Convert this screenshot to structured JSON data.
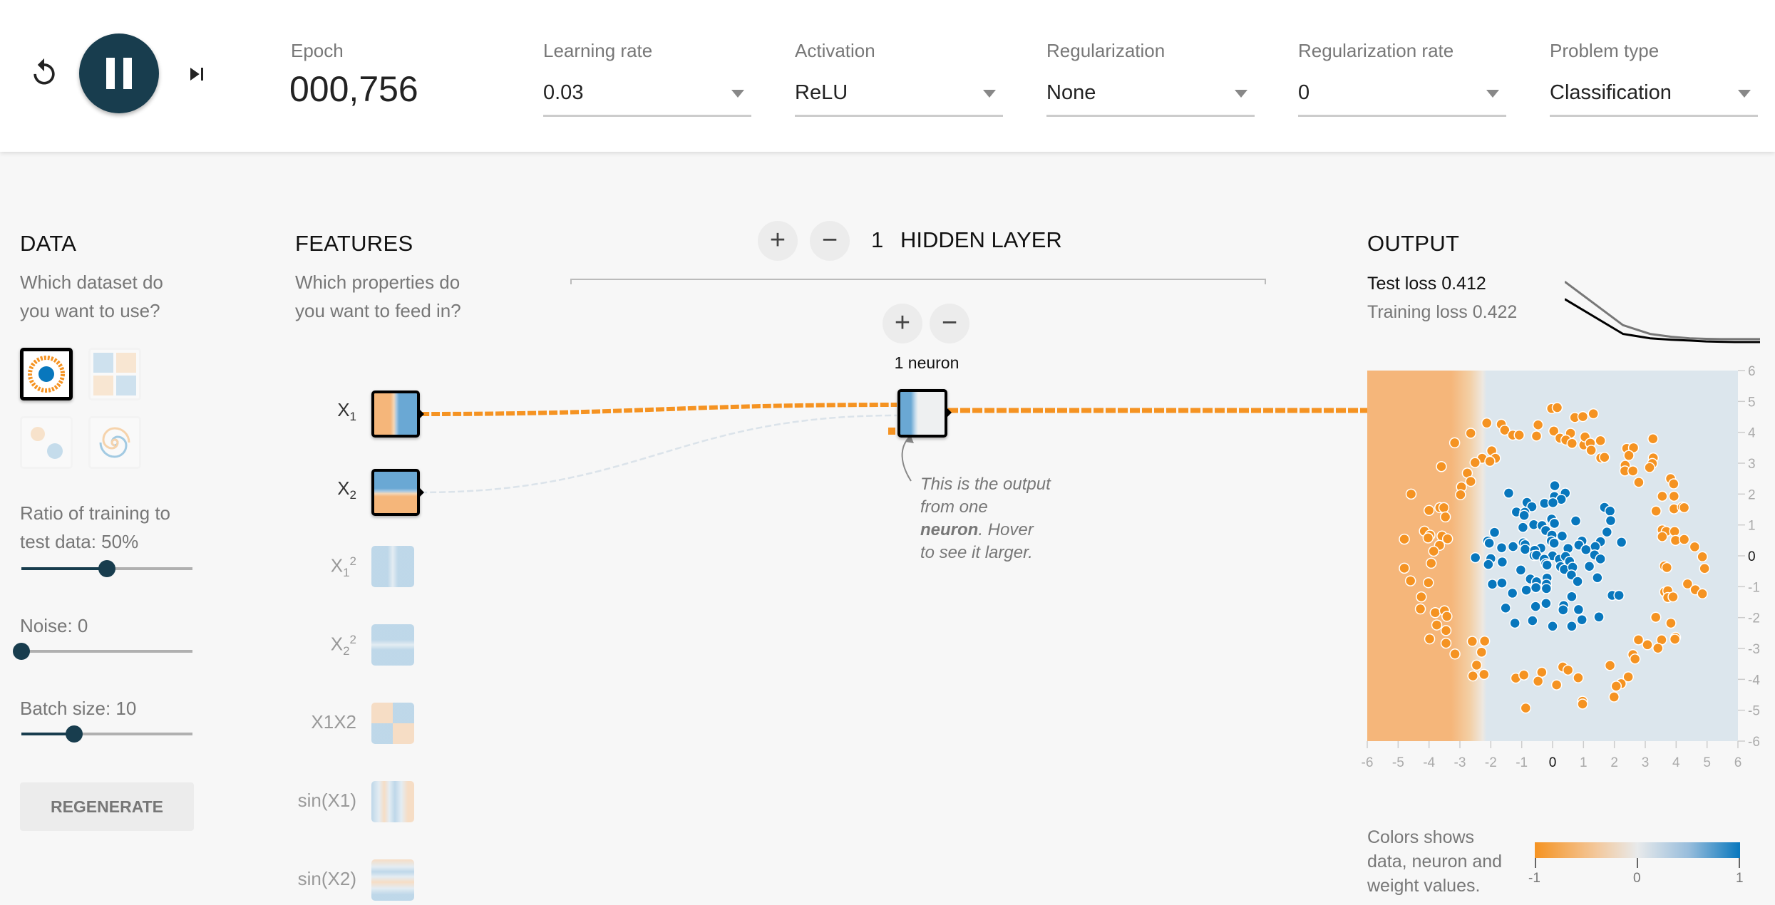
{
  "topbar": {
    "reset_icon": "reset-icon",
    "play_state": "pause",
    "step_icon": "step-forward-icon",
    "epoch_label": "Epoch",
    "epoch_value": "000,756",
    "controls": [
      {
        "label": "Learning rate",
        "value": "0.03"
      },
      {
        "label": "Activation",
        "value": "ReLU"
      },
      {
        "label": "Regularization",
        "value": "None"
      },
      {
        "label": "Regularization rate",
        "value": "0"
      },
      {
        "label": "Problem type",
        "value": "Classification"
      }
    ]
  },
  "data": {
    "title": "DATA",
    "subtitle_line1": "Which dataset do",
    "subtitle_line2": "you want to use?",
    "datasets": [
      {
        "name": "circle",
        "selected": true
      },
      {
        "name": "xor",
        "selected": false
      },
      {
        "name": "gaussian",
        "selected": false
      },
      {
        "name": "spiral",
        "selected": false
      }
    ],
    "ratio_label_line1": "Ratio of training to",
    "ratio_label_line2": "test data:  50%",
    "ratio_value": 50,
    "noise_label": "Noise:  0",
    "noise_value": 0,
    "batch_label": "Batch size:  10",
    "batch_value": 10,
    "regenerate_label": "REGENERATE"
  },
  "features": {
    "title": "FEATURES",
    "subtitle_line1": "Which properties do",
    "subtitle_line2": "you want to feed in?",
    "items": [
      {
        "label": "X",
        "sub": "1",
        "sup": "",
        "active": true
      },
      {
        "label": "X",
        "sub": "2",
        "sup": "",
        "active": true
      },
      {
        "label": "X",
        "sub": "1",
        "sup": "2",
        "active": false
      },
      {
        "label": "X",
        "sub": "2",
        "sup": "2",
        "active": false
      },
      {
        "label": "X1X2",
        "sub": "",
        "sup": "",
        "active": false
      },
      {
        "label": "sin(X1)",
        "sub": "",
        "sup": "",
        "active": false
      },
      {
        "label": "sin(X2)",
        "sub": "",
        "sup": "",
        "active": false
      }
    ]
  },
  "network": {
    "layer_count": "1",
    "layer_label": "HIDDEN LAYER",
    "add_layer": "+",
    "remove_layer": "−",
    "add_neuron": "+",
    "remove_neuron": "−",
    "neuron_count_label": "1 neuron",
    "note_line1": "This is the output",
    "note_line2": "from one",
    "note_bold": "neuron",
    "note_line3_rest": ". Hover",
    "note_line4": "to see it larger."
  },
  "output": {
    "title": "OUTPUT",
    "test_loss_label": "Test loss",
    "test_loss_value": "0.412",
    "training_loss_label": "Training loss",
    "training_loss_value": "0.422",
    "legend_text_line1": "Colors shows",
    "legend_text_line2": "data, neuron and",
    "legend_text_line3": "weight values.",
    "legend_ticks": [
      "-1",
      "0",
      "1"
    ]
  },
  "colors": {
    "orange": "#f59322",
    "blue": "#0877bd",
    "dark": "#183d4e",
    "bg_orange": "#f5b67a",
    "bg_blue": "#dce6ed"
  },
  "chart_data": {
    "type": "scatter",
    "title": "OUTPUT",
    "xlim": [
      -6,
      6
    ],
    "ylim": [
      -6,
      6
    ],
    "x_ticks": [
      "-6",
      "-5",
      "-4",
      "-3",
      "-2",
      "-1",
      "0",
      "1",
      "2",
      "3",
      "4",
      "5",
      "6"
    ],
    "y_ticks": [
      "6",
      "5",
      "4",
      "3",
      "2",
      "1",
      "0",
      "-1",
      "-2",
      "-3",
      "-4",
      "-5",
      "-6"
    ],
    "decision_boundary_x": -2.2,
    "series": [
      {
        "name": "orange (-1)",
        "color": "#f59322",
        "points": [
          [
            -0.03,
            4.77
          ],
          [
            0.15,
            4.8
          ],
          [
            0.72,
            4.48
          ],
          [
            0.98,
            4.51
          ],
          [
            1.32,
            4.6
          ],
          [
            -2.13,
            4.3
          ],
          [
            -1.66,
            4.26
          ],
          [
            -1.55,
            4.07
          ],
          [
            -0.47,
            4.24
          ],
          [
            0.04,
            4.04
          ],
          [
            -2.65,
            3.97
          ],
          [
            -1.29,
            3.91
          ],
          [
            -1.08,
            3.91
          ],
          [
            -0.52,
            3.88
          ],
          [
            0.58,
            3.97
          ],
          [
            -3.17,
            3.66
          ],
          [
            0.24,
            3.81
          ],
          [
            0.43,
            3.75
          ],
          [
            0.63,
            3.64
          ],
          [
            1.01,
            3.59
          ],
          [
            1.05,
            3.85
          ],
          [
            1.22,
            3.65
          ],
          [
            1.25,
            3.42
          ],
          [
            1.55,
            3.73
          ],
          [
            -1.97,
            3.4
          ],
          [
            -2.28,
            3.16
          ],
          [
            -1.85,
            3.16
          ],
          [
            -2.03,
            3.06
          ],
          [
            -2.51,
            3.02
          ],
          [
            -3.6,
            2.89
          ],
          [
            1.56,
            3.17
          ],
          [
            1.68,
            3.19
          ],
          [
            2.4,
            3.48
          ],
          [
            2.62,
            3.5
          ],
          [
            2.47,
            3.25
          ],
          [
            3.25,
            3.79
          ],
          [
            3.26,
            3.17
          ],
          [
            3.23,
            2.99
          ],
          [
            3.14,
            2.86
          ],
          [
            2.35,
            2.93
          ],
          [
            2.34,
            2.75
          ],
          [
            2.6,
            2.75
          ],
          [
            2.79,
            2.38
          ],
          [
            3.82,
            2.5
          ],
          [
            3.92,
            2.33
          ],
          [
            -2.76,
            2.68
          ],
          [
            -2.65,
            2.41
          ],
          [
            -2.95,
            2.23
          ],
          [
            -2.98,
            1.98
          ],
          [
            -4.58,
            2.0
          ],
          [
            3.55,
            1.93
          ],
          [
            3.93,
            1.93
          ],
          [
            3.35,
            1.45
          ],
          [
            3.93,
            1.52
          ],
          [
            4.2,
            1.58
          ],
          [
            4.26,
            1.56
          ],
          [
            -4.0,
            1.47
          ],
          [
            -3.65,
            1.56
          ],
          [
            -3.52,
            1.56
          ],
          [
            -3.47,
            1.26
          ],
          [
            -4.15,
            0.8
          ],
          [
            -3.97,
            0.67
          ],
          [
            -4.03,
            0.58
          ],
          [
            -3.58,
            0.64
          ],
          [
            -3.4,
            0.55
          ],
          [
            -3.66,
            0.34
          ],
          [
            -3.85,
            0.15
          ],
          [
            -4.8,
            0.54
          ],
          [
            3.55,
            0.84
          ],
          [
            3.68,
            0.79
          ],
          [
            3.55,
            0.62
          ],
          [
            3.95,
            0.79
          ],
          [
            3.98,
            0.5
          ],
          [
            4.26,
            0.53
          ],
          [
            4.6,
            0.29
          ],
          [
            4.85,
            -0.03
          ],
          [
            4.92,
            -0.41
          ],
          [
            -3.93,
            -0.24
          ],
          [
            -4.8,
            -0.4
          ],
          [
            -4.6,
            -0.81
          ],
          [
            -4.02,
            -0.87
          ],
          [
            -4.25,
            -1.33
          ],
          [
            3.62,
            -0.33
          ],
          [
            3.7,
            -0.38
          ],
          [
            4.37,
            -0.91
          ],
          [
            4.62,
            -1.1
          ],
          [
            4.85,
            -1.23
          ],
          [
            3.63,
            -1.17
          ],
          [
            3.73,
            -1.13
          ],
          [
            3.73,
            -1.35
          ],
          [
            3.9,
            -1.33
          ],
          [
            -4.28,
            -1.72
          ],
          [
            -3.8,
            -1.84
          ],
          [
            -3.5,
            -1.78
          ],
          [
            -3.42,
            -1.96
          ],
          [
            -3.75,
            -2.24
          ],
          [
            -3.45,
            -2.42
          ],
          [
            -3.98,
            -2.69
          ],
          [
            -3.45,
            -2.83
          ],
          [
            3.34,
            -1.99
          ],
          [
            3.83,
            -2.18
          ],
          [
            2.78,
            -2.72
          ],
          [
            3.07,
            -2.88
          ],
          [
            3.53,
            -2.72
          ],
          [
            3.41,
            -2.99
          ],
          [
            3.98,
            -2.64
          ],
          [
            3.96,
            -2.7
          ],
          [
            -2.6,
            -2.77
          ],
          [
            -2.2,
            -2.76
          ],
          [
            -2.3,
            -3.12
          ],
          [
            -3.16,
            -3.18
          ],
          [
            -2.46,
            -3.54
          ],
          [
            -2.58,
            -3.89
          ],
          [
            -2.22,
            -3.84
          ],
          [
            2.6,
            -3.2
          ],
          [
            2.67,
            -3.34
          ],
          [
            1.86,
            -3.55
          ],
          [
            2.45,
            -3.92
          ],
          [
            2.22,
            -4.14
          ],
          [
            2.06,
            -4.22
          ],
          [
            1.99,
            -4.57
          ],
          [
            -1.19,
            -3.96
          ],
          [
            -0.93,
            -3.86
          ],
          [
            -0.35,
            -3.77
          ],
          [
            -0.47,
            -4.06
          ],
          [
            0.33,
            -3.6
          ],
          [
            0.5,
            -3.7
          ],
          [
            0.83,
            -3.95
          ],
          [
            0.13,
            -4.18
          ],
          [
            0.97,
            -4.71
          ],
          [
            0.97,
            -4.8
          ],
          [
            -0.87,
            -4.93
          ]
        ]
      },
      {
        "name": "blue (+1)",
        "color": "#0877bd",
        "points": [
          [
            0.07,
            2.27
          ],
          [
            0.41,
            2.03
          ],
          [
            -1.42,
            2.03
          ],
          [
            0.06,
            1.92
          ],
          [
            0.28,
            1.83
          ],
          [
            -0.83,
            1.73
          ],
          [
            -0.26,
            1.7
          ],
          [
            0.01,
            1.72
          ],
          [
            -0.67,
            1.59
          ],
          [
            -1.17,
            1.42
          ],
          [
            -0.9,
            1.41
          ],
          [
            -0.92,
            1.31
          ],
          [
            1.68,
            1.57
          ],
          [
            1.86,
            1.45
          ],
          [
            1.88,
            1.14
          ],
          [
            -0.03,
            1.19
          ],
          [
            0.06,
            1.05
          ],
          [
            -0.61,
            1.01
          ],
          [
            -0.34,
            0.98
          ],
          [
            0.75,
            1.13
          ],
          [
            -0.96,
            0.92
          ],
          [
            -0.22,
            0.82
          ],
          [
            -1.88,
            0.76
          ],
          [
            -0.02,
            0.67
          ],
          [
            0.31,
            0.64
          ],
          [
            1.76,
            0.77
          ],
          [
            -2.1,
            0.48
          ],
          [
            -2.05,
            0.41
          ],
          [
            0.95,
            0.48
          ],
          [
            1.55,
            0.46
          ],
          [
            2.23,
            0.44
          ],
          [
            -0.95,
            0.42
          ],
          [
            -0.89,
            0.36
          ],
          [
            -0.04,
            0.48
          ],
          [
            0.05,
            0.41
          ],
          [
            0.85,
            0.35
          ],
          [
            1.38,
            0.3
          ],
          [
            -1.65,
            0.26
          ],
          [
            -1.28,
            0.3
          ],
          [
            -0.38,
            0.25
          ],
          [
            -0.89,
            0.21
          ],
          [
            -0.58,
            0.18
          ],
          [
            0.5,
            0.24
          ],
          [
            1.08,
            0.2
          ],
          [
            -0.6,
            0.01
          ],
          [
            -0.52,
            0.02
          ],
          [
            0.0,
            0.0
          ],
          [
            1.36,
            0.03
          ],
          [
            -2.5,
            -0.06
          ],
          [
            -2.0,
            -0.09
          ],
          [
            -1.63,
            -0.2
          ],
          [
            -0.27,
            -0.11
          ],
          [
            -0.22,
            -0.25
          ],
          [
            0.22,
            -0.11
          ],
          [
            0.42,
            -0.02
          ],
          [
            0.55,
            -0.18
          ],
          [
            1.55,
            -0.1
          ],
          [
            -2.08,
            -0.28
          ],
          [
            -0.18,
            -0.3
          ],
          [
            0.26,
            -0.35
          ],
          [
            0.38,
            -0.44
          ],
          [
            0.65,
            -0.37
          ],
          [
            1.19,
            -0.34
          ],
          [
            -1.03,
            -0.46
          ],
          [
            -0.72,
            -0.75
          ],
          [
            -0.52,
            -0.84
          ],
          [
            -0.18,
            -0.72
          ],
          [
            -0.2,
            -0.92
          ],
          [
            0.61,
            -0.62
          ],
          [
            0.81,
            -0.83
          ],
          [
            1.45,
            -0.71
          ],
          [
            -1.95,
            -0.92
          ],
          [
            -1.64,
            -0.88
          ],
          [
            -0.85,
            -1.11
          ],
          [
            -0.54,
            -1.03
          ],
          [
            -0.2,
            -1.06
          ],
          [
            -1.3,
            -1.21
          ],
          [
            1.93,
            -1.28
          ],
          [
            2.15,
            -1.28
          ],
          [
            0.62,
            -1.32
          ],
          [
            -0.21,
            -1.54
          ],
          [
            0.36,
            -1.61
          ],
          [
            -0.55,
            -1.64
          ],
          [
            -1.52,
            -1.69
          ],
          [
            0.34,
            -1.75
          ],
          [
            0.84,
            -1.74
          ],
          [
            1.5,
            -1.98
          ],
          [
            -1.22,
            -2.18
          ],
          [
            -0.65,
            -2.1
          ],
          [
            0.0,
            -2.28
          ],
          [
            0.62,
            -2.28
          ],
          [
            0.95,
            -2.07
          ]
        ]
      }
    ]
  },
  "loss_chart": {
    "series": [
      {
        "name": "Training loss",
        "color": "#777",
        "values": [
          0.62,
          0.47,
          0.44,
          0.43,
          0.425,
          0.423,
          0.422,
          0.422,
          0.422,
          0.422
        ]
      },
      {
        "name": "Test loss",
        "color": "#000",
        "values": [
          0.56,
          0.44,
          0.425,
          0.42,
          0.417,
          0.414,
          0.413,
          0.412,
          0.412,
          0.412
        ]
      }
    ]
  }
}
